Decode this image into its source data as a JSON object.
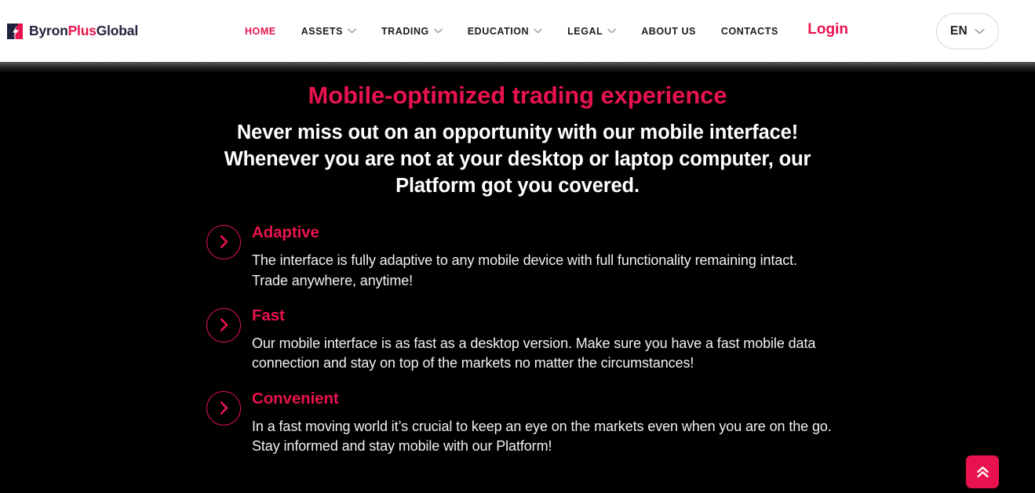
{
  "colors": {
    "accent": "#e8134e",
    "brand_dark": "#20223c",
    "header_bg": "#ffffff",
    "hero_bg": "#000000",
    "body_text": "#f2f2f2",
    "nav_text": "#1b1b1b",
    "caret": "#9b9b9b"
  },
  "header": {
    "brand": {
      "icon": "byronplusglobal-logo-mark",
      "part_one": "Byron",
      "part_two": "Plus",
      "part_three": "Global",
      "full_text": "ByronPlusGlobal"
    },
    "nav": [
      {
        "label": "HOME",
        "active": true,
        "has_dropdown": false,
        "name": "home"
      },
      {
        "label": "ASSETS",
        "active": false,
        "has_dropdown": true,
        "name": "assets"
      },
      {
        "label": "TRADING",
        "active": false,
        "has_dropdown": true,
        "name": "trading"
      },
      {
        "label": "EDUCATION",
        "active": false,
        "has_dropdown": true,
        "name": "education"
      },
      {
        "label": "LEGAL",
        "active": false,
        "has_dropdown": true,
        "name": "legal"
      },
      {
        "label": "ABOUT US",
        "active": false,
        "has_dropdown": false,
        "name": "about-us"
      },
      {
        "label": "CONTACTS",
        "active": false,
        "has_dropdown": false,
        "name": "contacts"
      }
    ],
    "login_label": "Login",
    "language": {
      "selected": "EN",
      "icon": "chevron-down-icon"
    }
  },
  "hero": {
    "title": "Mobile-optimized trading experience",
    "subtitle": "Never miss out on an opportunity with our mobile interface! Whenever you are not at your desktop or laptop computer, our Platform got you covered.",
    "features": [
      {
        "icon": "chevron-right-circle-icon",
        "title": "Adaptive",
        "text": "The interface is fully adaptive to any mobile device with full functionality remaining intact. Trade anywhere, anytime!"
      },
      {
        "icon": "chevron-right-circle-icon",
        "title": "Fast",
        "text": "Our mobile interface is as fast as a desktop version. Make sure you have a fast mobile data connection and stay on top of the markets no matter the circumstances!"
      },
      {
        "icon": "chevron-right-circle-icon",
        "title": "Convenient",
        "text": "In a fast moving world it’s crucial to keep an eye on the markets even when you are on the go. Stay informed and stay mobile with our Platform!"
      }
    ]
  },
  "scroll_top_button": {
    "icon": "double-chevron-up-icon",
    "label": ""
  }
}
